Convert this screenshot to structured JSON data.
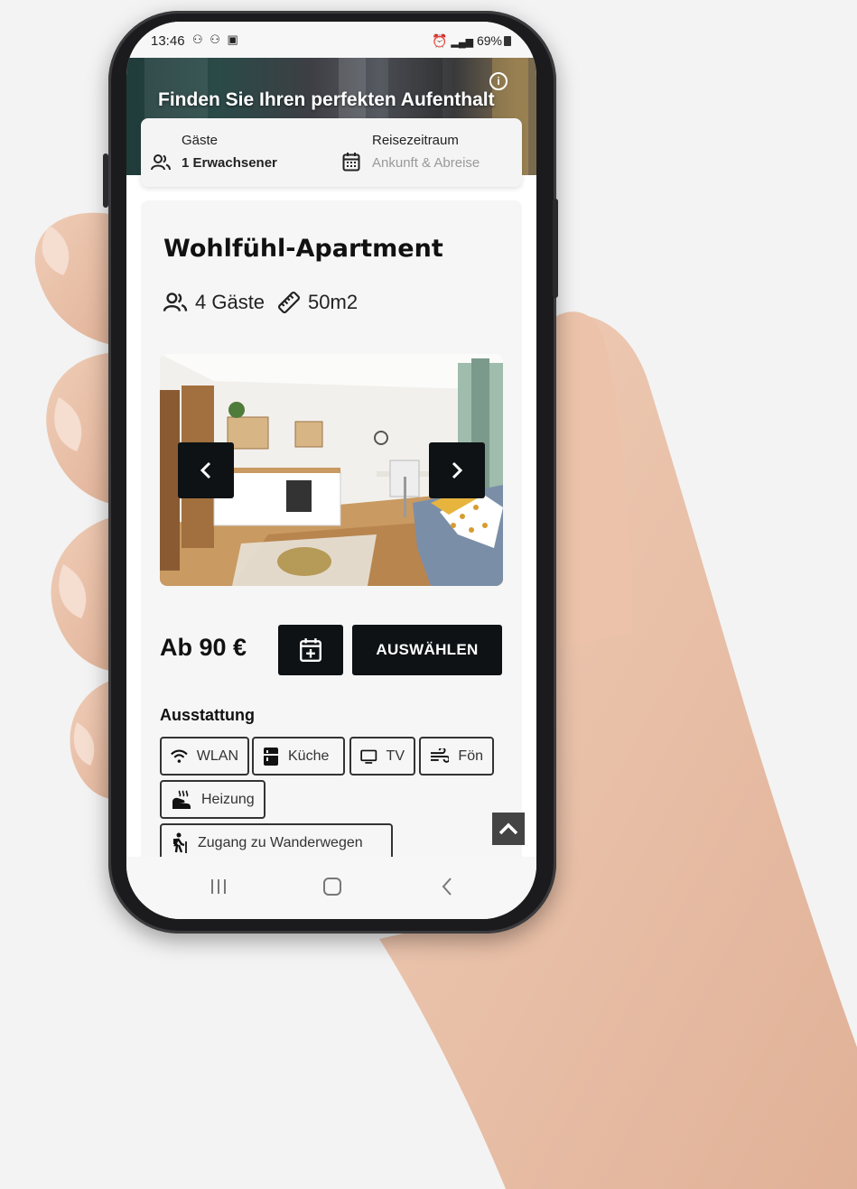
{
  "status_bar": {
    "time": "13:46",
    "left_icons": "⚇ ⚇ ▣",
    "right_text": "69%"
  },
  "hero": {
    "title": "Finden Sie Ihren perfekten Aufenthalt",
    "info_icon": "info-icon"
  },
  "search": {
    "guests_label": "Gäste",
    "guests_value": "1 Erwachsener",
    "period_label": "Reisezeitraum",
    "period_placeholder": "Ankunft & Abreise"
  },
  "listing": {
    "title": "Wohlfühl-Apartment",
    "guests": "4 Gäste",
    "size": "50m2",
    "price": "Ab 90 €",
    "select_label": "AUSWÄHLEN"
  },
  "amenities": {
    "title": "Ausstattung",
    "items": [
      "WLAN",
      "Küche",
      "TV",
      "Fön",
      "Heizung",
      "Zugang zu Wanderwegen"
    ]
  },
  "colors": {
    "primary": "#0e1214",
    "card": "#f6f6f6"
  }
}
